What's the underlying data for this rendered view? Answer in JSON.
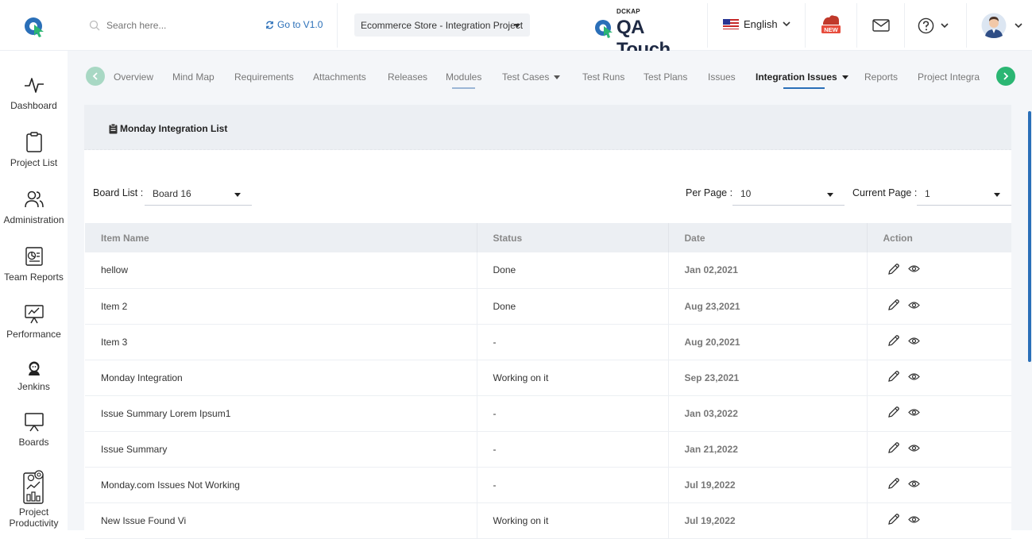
{
  "header": {
    "search_placeholder": "Search here...",
    "goto_label": "Go to V1.0",
    "project_name": "Ecommerce Store - Integration Project",
    "brand_small": "DCKAP",
    "brand_name": "QA Touch",
    "language": "English",
    "new_badge": "NEW"
  },
  "sidebar": {
    "items": [
      {
        "label": "Dashboard",
        "icon": "pulse-icon"
      },
      {
        "label": "Project List",
        "icon": "clipboard-icon"
      },
      {
        "label": "Administration",
        "icon": "users-icon"
      },
      {
        "label": "Team Reports",
        "icon": "report-icon"
      },
      {
        "label": "Performance",
        "icon": "performance-icon"
      },
      {
        "label": "Jenkins",
        "icon": "jenkins-icon"
      },
      {
        "label": "Boards",
        "icon": "board-icon"
      },
      {
        "label": "Project Productivity",
        "icon": "productivity-icon"
      }
    ]
  },
  "tabs": [
    {
      "label": "Overview"
    },
    {
      "label": "Mind Map"
    },
    {
      "label": "Requirements"
    },
    {
      "label": "Attachments"
    },
    {
      "label": "Releases"
    },
    {
      "label": "Modules"
    },
    {
      "label": "Test Cases"
    },
    {
      "label": "Test Runs"
    },
    {
      "label": "Test Plans"
    },
    {
      "label": "Issues"
    },
    {
      "label": "Integration Issues"
    },
    {
      "label": "Reports"
    },
    {
      "label": "Project Integra"
    }
  ],
  "panel": {
    "title": "Monday Integration List",
    "board_label": "Board List :",
    "board_value": "Board 16",
    "per_page_label": "Per Page :",
    "per_page_value": "10",
    "current_page_label": "Current Page :",
    "current_page_value": "1"
  },
  "table": {
    "columns": [
      "Item Name",
      "Status",
      "Date",
      "Action"
    ],
    "rows": [
      {
        "name": "hellow",
        "status": "Done",
        "date": "Jan 02,2021"
      },
      {
        "name": "Item 2",
        "status": "Done",
        "date": "Aug 23,2021"
      },
      {
        "name": "Item 3",
        "status": "-",
        "date": "Aug 20,2021"
      },
      {
        "name": "Monday Integration",
        "status": "Working on it",
        "date": "Sep 23,2021"
      },
      {
        "name": "Issue Summary Lorem Ipsum1",
        "status": "-",
        "date": "Jan 03,2022"
      },
      {
        "name": "Issue Summary",
        "status": "-",
        "date": "Jan 21,2022"
      },
      {
        "name": "Monday.com Issues Not Working",
        "status": "-",
        "date": "Jul 19,2022"
      },
      {
        "name": "New Issue Found Vi",
        "status": "Working on it",
        "date": "Jul 19,2022"
      }
    ]
  },
  "colors": {
    "accent": "#2a6fb8",
    "green": "#2bb673"
  }
}
